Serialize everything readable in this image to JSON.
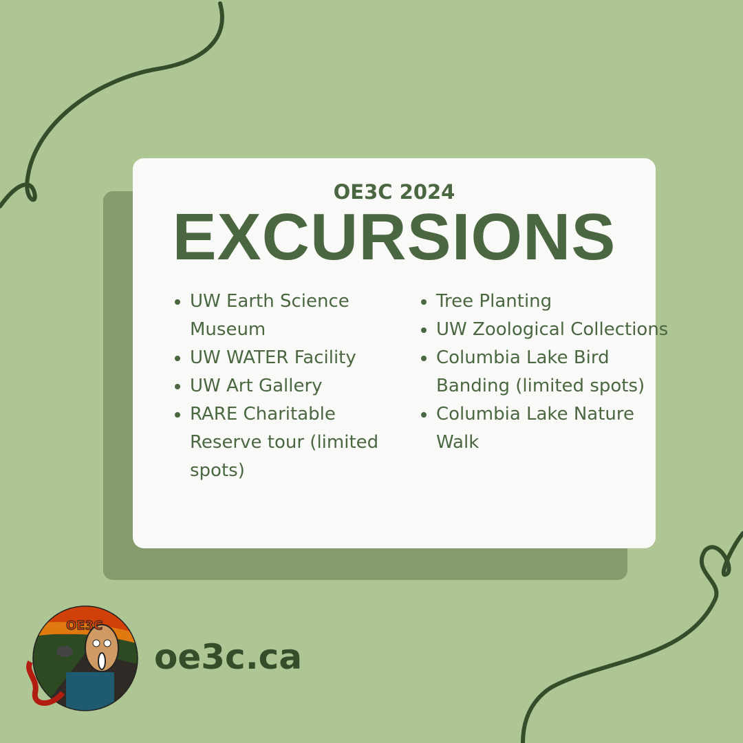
{
  "header": {
    "subtitle": "OE3C 2024",
    "title": "EXCURSIONS"
  },
  "excursions": {
    "left": [
      "UW Earth Science Museum",
      "UW WATER Facility",
      "UW Art Gallery",
      "RARE Charitable Reserve tour (limited spots)"
    ],
    "right": [
      "Tree Planting",
      "UW Zoological Collections",
      "Columbia Lake Bird Banding (limited spots)",
      "Columbia Lake Nature Walk"
    ]
  },
  "footer": {
    "website": "oe3c.ca",
    "logo_text": "OE3C"
  },
  "colors": {
    "background": "#aec594",
    "card": "#f9f9f7",
    "shadow": "#849b6d",
    "text": "#4a6741",
    "dark": "#344d2a"
  }
}
